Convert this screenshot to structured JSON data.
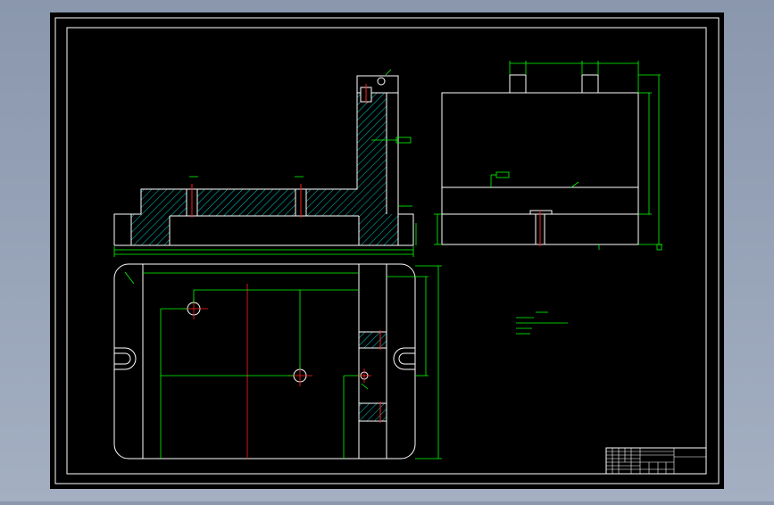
{
  "drawing": {
    "background_color": "#000000",
    "line_color": "#ffffff",
    "dim_color": "#00ff00",
    "center_color": "#ff0000",
    "hatch_color": "#00d0d0",
    "leader_label_1": "",
    "leader_label_2": "",
    "leader_label_3": "",
    "notes": {
      "title": "",
      "lines": [
        "",
        "",
        "",
        ""
      ]
    }
  }
}
